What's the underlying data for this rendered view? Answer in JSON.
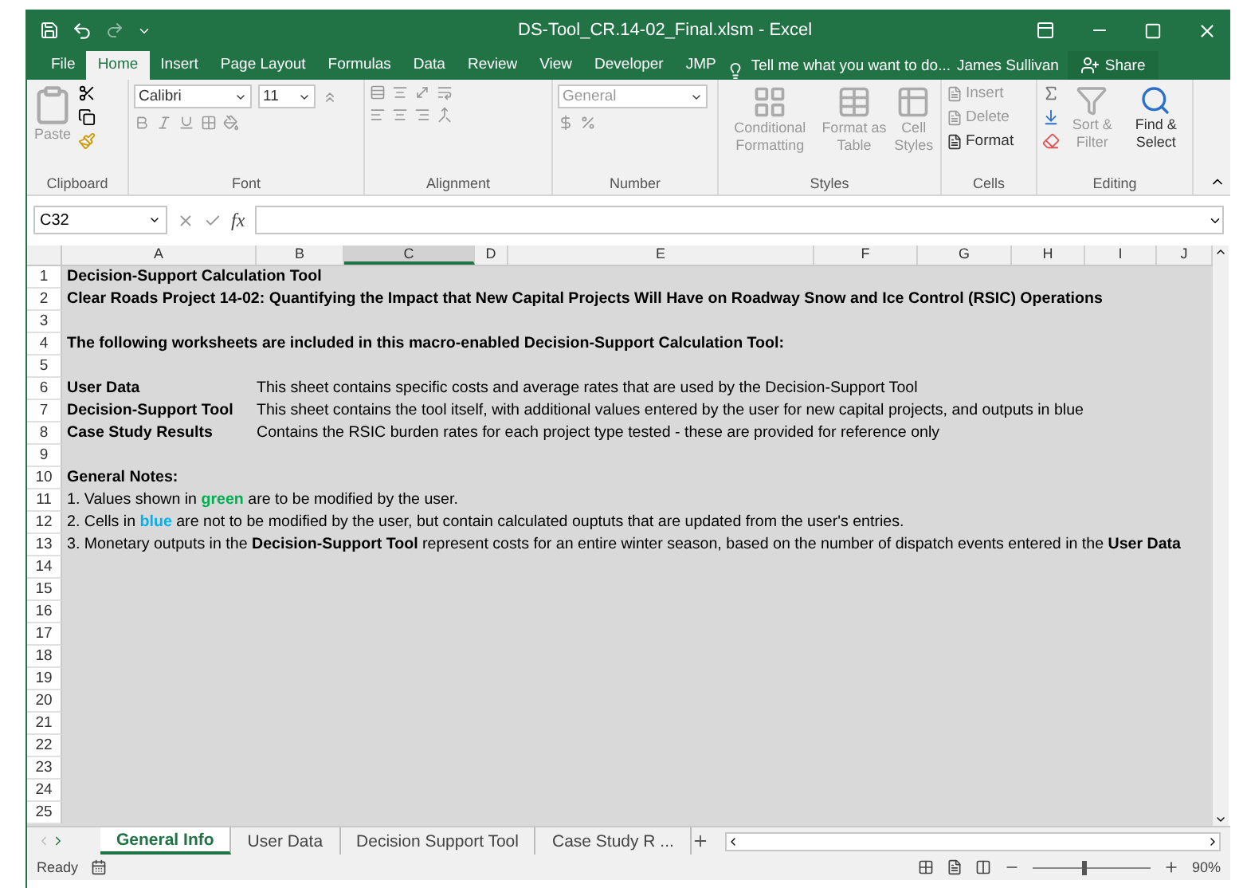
{
  "window": {
    "title": "DS-Tool_CR.14-02_Final.xlsm - Excel"
  },
  "ribbon_tabs": [
    {
      "label": "File",
      "selected": false
    },
    {
      "label": "Home",
      "selected": true
    },
    {
      "label": "Insert",
      "selected": false
    },
    {
      "label": "Page Layout",
      "selected": false
    },
    {
      "label": "Formulas",
      "selected": false
    },
    {
      "label": "Data",
      "selected": false
    },
    {
      "label": "Review",
      "selected": false
    },
    {
      "label": "View",
      "selected": false
    },
    {
      "label": "Developer",
      "selected": false
    },
    {
      "label": "JMP",
      "selected": false
    }
  ],
  "tell_me": "Tell me what you want to do...",
  "user": "James Sullivan",
  "share": "Share",
  "ribbon": {
    "paste": {
      "label": "Paste",
      "disabled": true
    },
    "font_name": "Calibri",
    "font_size": "11",
    "number_format": "General",
    "styles": [
      {
        "label": "Conditional Formatting",
        "disabled": true
      },
      {
        "label": "Format as Table",
        "disabled": true
      },
      {
        "label": "Cell Styles",
        "disabled": true
      }
    ],
    "cells": [
      {
        "label": "Insert",
        "disabled": true
      },
      {
        "label": "Delete",
        "disabled": true
      },
      {
        "label": "Format",
        "disabled": false
      }
    ],
    "editing": [
      {
        "label": "Sort & Filter",
        "disabled": true
      },
      {
        "label": "Find & Select",
        "disabled": false
      }
    ],
    "groups": [
      "Clipboard",
      "Font",
      "Alignment",
      "Number",
      "Styles",
      "Cells",
      "Editing"
    ]
  },
  "formula_bar": {
    "name_box": "C32",
    "fx": "fx"
  },
  "columns": [
    {
      "label": "A",
      "selected": false
    },
    {
      "label": "B",
      "selected": false
    },
    {
      "label": "C",
      "selected": true
    },
    {
      "label": "D",
      "selected": false
    },
    {
      "label": "E",
      "selected": false
    },
    {
      "label": "F",
      "selected": false
    },
    {
      "label": "G",
      "selected": false
    },
    {
      "label": "H",
      "selected": false
    },
    {
      "label": "I",
      "selected": false
    },
    {
      "label": "J",
      "selected": false
    }
  ],
  "rows": [
    {
      "n": "1",
      "a": "**Decision-Support Calculation Tool**"
    },
    {
      "n": "2",
      "a": "**Clear Roads Project 14-02: Quantifying the Impact that New Capital Projects Will Have on Roadway Snow and Ice Control (RSIC) Operations**"
    },
    {
      "n": "3"
    },
    {
      "n": "4",
      "a": "**The following worksheets are included in this macro-enabled Decision-Support Calculation Tool:**"
    },
    {
      "n": "5"
    },
    {
      "n": "6",
      "a": "**User Data**",
      "b": "This sheet contains specific costs and average rates that are used by the Decision-Support Tool"
    },
    {
      "n": "7",
      "a": "**Decision-Support Tool**",
      "b": "This sheet contains the tool itself, with additional values entered by the user for new capital projects, and outputs in blue"
    },
    {
      "n": "8",
      "a": "**Case Study Results**",
      "b": "Contains the RSIC burden rates for each project type tested - these are provided for reference only"
    },
    {
      "n": "9"
    },
    {
      "n": "10",
      "a": "**General Notes:**"
    },
    {
      "n": "11",
      "segments": [
        {
          "text": "1. Values shown in "
        },
        {
          "text": "green",
          "color": "#00b050"
        },
        {
          "text": " are to be modified by the user."
        }
      ]
    },
    {
      "n": "12",
      "segments": [
        {
          "text": "2. Cells in "
        },
        {
          "text": "blue",
          "color": "#00b0f0"
        },
        {
          "text": " are not to be modified by the user, but contain calculated ouptuts that are updated from the user's entries."
        }
      ]
    },
    {
      "n": "13",
      "a": "3. Monetary outputs in the **Decision-Support Tool** represent costs for an entire winter season, based on the number of dispatch events entered in the **User Data**"
    },
    {
      "n": "14"
    },
    {
      "n": "15"
    },
    {
      "n": "16"
    },
    {
      "n": "17"
    },
    {
      "n": "18"
    },
    {
      "n": "19"
    },
    {
      "n": "20"
    },
    {
      "n": "21"
    },
    {
      "n": "22"
    },
    {
      "n": "23"
    },
    {
      "n": "24"
    },
    {
      "n": "25"
    }
  ],
  "sheet_tabs": [
    {
      "label": "General Info",
      "selected": true
    },
    {
      "label": "User Data",
      "selected": false
    },
    {
      "label": "Decision Support Tool",
      "selected": false
    },
    {
      "label": "Case Study R ...",
      "selected": false
    }
  ],
  "status_bar": {
    "ready": "Ready",
    "zoom": "90%",
    "zoom_slider": {
      "level": 0.42
    }
  }
}
